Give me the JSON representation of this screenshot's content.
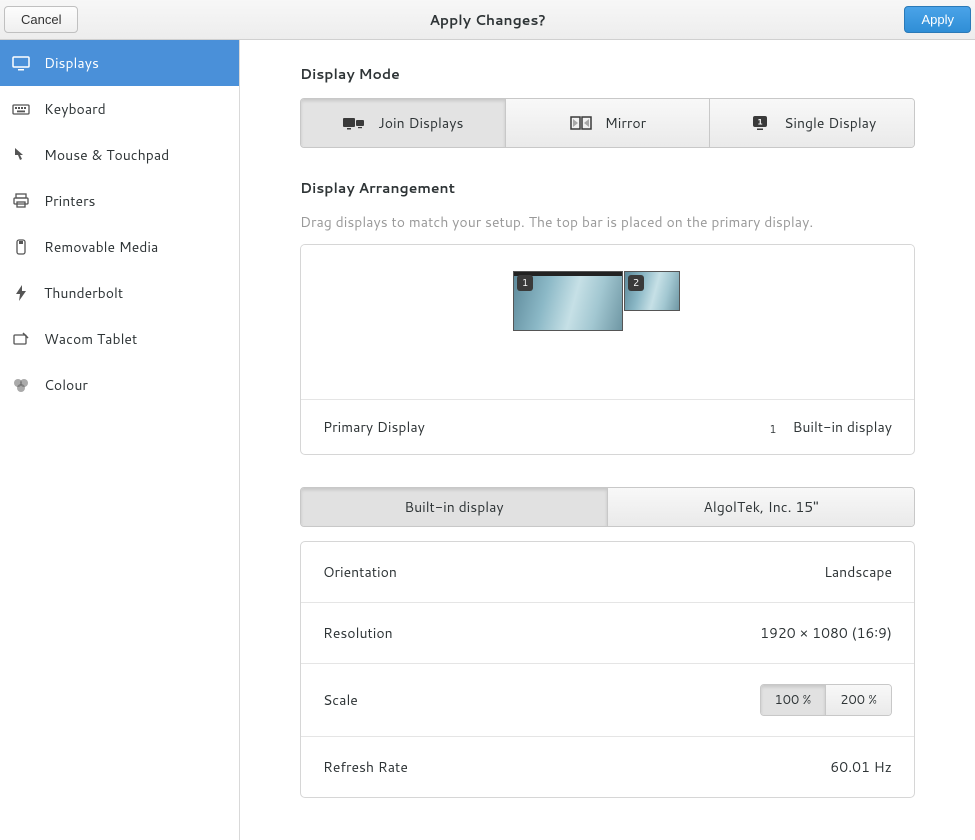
{
  "header": {
    "title": "Apply Changes?",
    "cancel_label": "Cancel",
    "apply_label": "Apply"
  },
  "sidebar": {
    "items": [
      {
        "label": "Displays"
      },
      {
        "label": "Keyboard"
      },
      {
        "label": "Mouse & Touchpad"
      },
      {
        "label": "Printers"
      },
      {
        "label": "Removable Media"
      },
      {
        "label": "Thunderbolt"
      },
      {
        "label": "Wacom Tablet"
      },
      {
        "label": "Colour"
      }
    ]
  },
  "display_mode": {
    "title": "Display Mode",
    "join_label": "Join Displays",
    "mirror_label": "Mirror",
    "single_label": "Single Display"
  },
  "arrangement": {
    "title": "Display Arrangement",
    "help": "Drag displays to match your setup. The top bar is placed on the primary display.",
    "primary_label": "Primary Display",
    "primary_num": "1",
    "primary_name": "Built-in display",
    "display1_badge": "1",
    "display2_badge": "2"
  },
  "tabs": {
    "builtin": "Built-in display",
    "external": "AlgolTek, Inc. 15\""
  },
  "settings": {
    "orientation_label": "Orientation",
    "orientation_value": "Landscape",
    "resolution_label": "Resolution",
    "resolution_value": "1920 × 1080 (16∶9)",
    "scale_label": "Scale",
    "scale_100": "100 %",
    "scale_200": "200 %",
    "refresh_label": "Refresh Rate",
    "refresh_value": "60.01 Hz"
  }
}
